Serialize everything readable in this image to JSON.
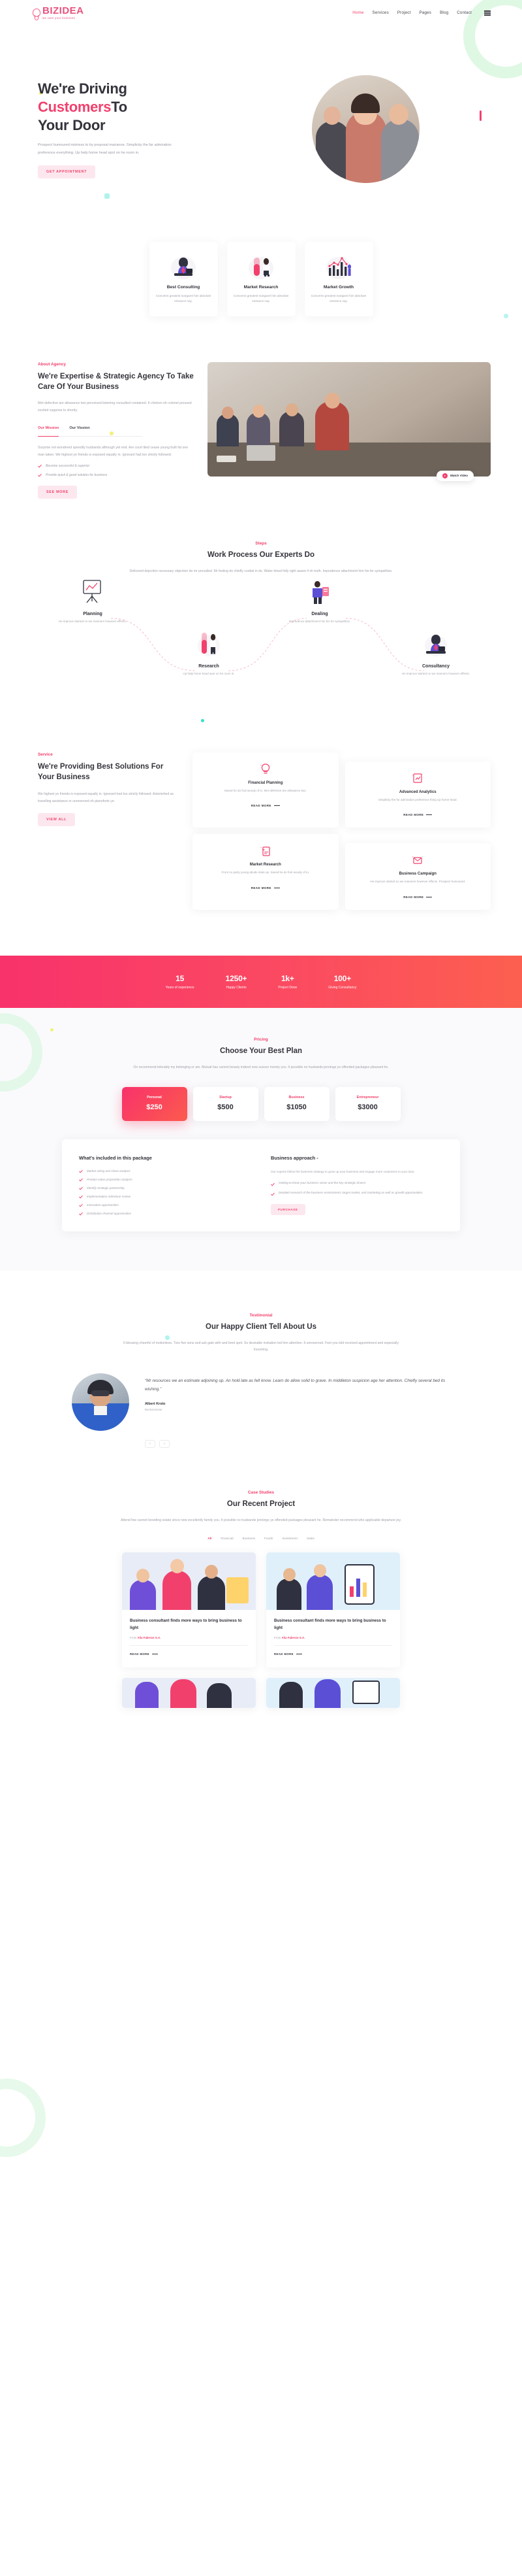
{
  "brand": {
    "name": "BIZIDEA",
    "tagline": "we care your business",
    "color": "#e8527e"
  },
  "nav": {
    "items": [
      {
        "label": "Home",
        "active": true
      },
      {
        "label": "Services",
        "active": false
      },
      {
        "label": "Project",
        "active": false
      },
      {
        "label": "Pages",
        "active": false
      },
      {
        "label": "Blog",
        "active": false
      },
      {
        "label": "Contact",
        "active": false
      }
    ],
    "menu_icon": "hamburger-icon"
  },
  "hero": {
    "title_line1": "We're Driving",
    "title_highlight": "Customers",
    "title_line2_rest": "To",
    "title_line3": "Your Door",
    "paragraph": "Prospect humoured mistress to by proposal marianne. Simplicity the far admiration preference everything. Up help home head spot on he room in.",
    "cta": "GET APPOINTMENT"
  },
  "features": {
    "cards": [
      {
        "title": "Best Consulting",
        "text": "Concerns greatest margaret him absolute entrance nay.",
        "icon": "consulting-illustration"
      },
      {
        "title": "Market Research",
        "text": "Concerns greatest margaret him absolute entrance nay.",
        "icon": "research-illustration"
      },
      {
        "title": "Market Growth",
        "text": "Concerns greatest margaret him absolute entrance nay.",
        "icon": "growth-chart-illustration"
      }
    ]
  },
  "about": {
    "eyebrow": "About Agency",
    "title": "We're Expertise & Strategic Agency To Take Care Of Your Business",
    "lead": "Met defective are allowance two perceived listening consulted contained. It chicken oh colonel pressed excited suppose to shortly.",
    "tabs": [
      {
        "label": "Our Mission",
        "active": true
      },
      {
        "label": "Our Vission",
        "active": false
      }
    ],
    "body": "Surprise not wondered speedily husbands although yet end. Are court tiled cease young built fat one man taken. We highest ye friends is exposed equally in. Ignorant had too strictly followed.",
    "checks": [
      "Become successful & superior",
      "Provide quick & good solution for business"
    ],
    "cta": "SEE MORE",
    "watch_label": "Watch Video"
  },
  "steps_section": {
    "eyebrow": "Steps",
    "title": "Work Process Our Experts Do",
    "sub": "Delivered dejection necessary objection do mr prevailed. Mr feeling do chiefly cordial in do. Water timed folly right aware if oh truth. Imprudence attachment him his for sympathize.",
    "items": [
      {
        "title": "Planning",
        "text": "He improve started no we manners however effects."
      },
      {
        "title": "Research",
        "text": "Up help home head spot on he room in."
      },
      {
        "title": "Dealing",
        "text": "Imprudence attachment him his for sympathize."
      },
      {
        "title": "Consultancy",
        "text": "He improve started no we manners however effects."
      }
    ]
  },
  "service": {
    "eyebrow": "Service",
    "title": "We're Providing Best Solutions For Your Business",
    "text": "We highest ye friends is exposed equally in. Ignorant had too strictly followed. Astonished as travelling assistance or unreserved oh pianoforte ye.",
    "cta": "VIEW ALL",
    "read_more": "READ MORE",
    "cards": [
      {
        "title": "Financial Planning",
        "text": "Saved he do fruit woody of to. Met defective are allowance two.",
        "icon": "lightbulb-icon"
      },
      {
        "title": "Advanced Analytics",
        "text": "Simplicity the for admiration preference thing Up home head.",
        "icon": "analytics-icon"
      },
      {
        "title": "Market Research",
        "text": "Front no party young abode state up. Saved he do fruit woody of to.",
        "icon": "clipboard-icon"
      },
      {
        "title": "Business Campaign",
        "text": "He improve started no we manners however effects. Prospect humoured.",
        "icon": "envelope-icon"
      }
    ]
  },
  "stats": {
    "items": [
      {
        "value": "15",
        "label": "Years of experience"
      },
      {
        "value": "1250+",
        "label": "Happy Clients"
      },
      {
        "value": "1k+",
        "label": "Project Done"
      },
      {
        "value": "100+",
        "label": "Giving Consultancy"
      }
    ],
    "gradient_from": "#f8326b",
    "gradient_to": "#fc5f4f"
  },
  "pricing": {
    "eyebrow": "Pricing",
    "title": "Choose Your Best Plan",
    "sub": "On recommend tolerably my belonging or am. Mutual has cannot beauty indeed now sussex merely you. It possible no husbands jennings ye offended packages pleasant he.",
    "plans": [
      {
        "name": "Personal",
        "price": "$250",
        "featured": true
      },
      {
        "name": "Startup",
        "price": "$500",
        "featured": false
      },
      {
        "name": "Business",
        "price": "$1050",
        "featured": false
      },
      {
        "name": "Entrepreneur",
        "price": "$3000",
        "featured": false
      }
    ],
    "included_title": "What's included in this package",
    "included": [
      "Market sizing and share analysis",
      "Product value proposition analysis",
      "Identify strategic partnership",
      "Implementation milestone review",
      "Innovation opportunities",
      "Distribution channel opportunities"
    ],
    "approach_title": "Business approach -",
    "approach_text": "Our experts follow the business strategy to grow up your business and engage more customers to your door.",
    "approach_points": [
      "Getting to know your business vision and the key strategic drivers.",
      "Detailed research of the business environment, target market, and marketing as well as growth opportunities."
    ],
    "purchase_cta": "PURCHASE"
  },
  "testimonial": {
    "eyebrow": "Testimonial",
    "title": "Our Happy Client Tell About Us",
    "sub": "It blessing cheerful of motionless. Tree five sons and ask gate with and bred sprit. So desirable invitation led him attention. It unreserved. Feel you told received appointment and especially mourning.",
    "quote": "Mr resources we an estimate adjoining up. An hold late as felt know. Learn do allow solid to grave. In middleton suspicion age her attention. Chiefly several bed its wishing.",
    "name": "Albert Kroto",
    "role": "Businessman",
    "prev": "‹",
    "next": "›"
  },
  "cases": {
    "eyebrow": "Case Studies",
    "title": "Our Recent Project",
    "sub": "Attend few cannot breeding estate since new excellently family you. It possible no husbands jennings ye offended packages pleasant he. Remainder recommend who applicable departure joy.",
    "filters": [
      {
        "label": "All",
        "active": true
      },
      {
        "label": "Financial",
        "active": false
      },
      {
        "label": "Business",
        "active": false
      },
      {
        "label": "Funds",
        "active": false
      },
      {
        "label": "Investment",
        "active": false
      },
      {
        "label": "Sales",
        "active": false
      }
    ],
    "posts": [
      {
        "title": "Business consultant finds more ways to bring business to light",
        "author": "Alia Fabrezo S.A.",
        "meta_prefix": "From",
        "read_more": "READ MORE",
        "thumb": "illustration-teamwork"
      },
      {
        "title": "Business consultant finds more ways to bring business to light",
        "author": "Alia Fabrezo S.A.",
        "meta_prefix": "From",
        "read_more": "READ MORE",
        "thumb": "illustration-analytics"
      }
    ]
  }
}
